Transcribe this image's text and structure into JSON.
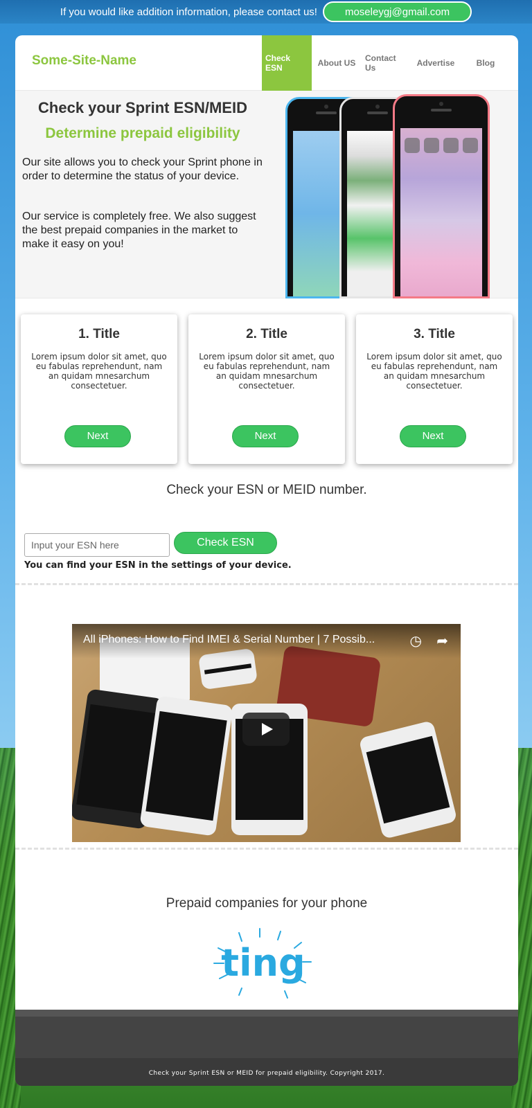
{
  "topbar": {
    "message": "If you would like addition information, please contact us!",
    "email": "moseleygj@gmail.com"
  },
  "header": {
    "site_name": "Some-Site-Name",
    "nav": [
      {
        "label": "Check ESN",
        "active": true
      },
      {
        "label": "About US"
      },
      {
        "label": "Contact Us"
      },
      {
        "label": "Advertise"
      },
      {
        "label": "Blog"
      }
    ]
  },
  "hero": {
    "title": "Check your Sprint ESN/MEID",
    "subtitle": "Determine prepaid eligibility",
    "paragraph1": "Our site allows you to check your Sprint phone in order to determine the status of your device.",
    "paragraph2": "Our service is completely free. We also suggest the best prepaid companies in the market to make it easy on you!"
  },
  "cards": [
    {
      "title": "1. Title",
      "text": "Lorem ipsum dolor sit amet, quo eu fabulas reprehendunt, nam an quidam mnesarchum consectetuer.",
      "button": "Next"
    },
    {
      "title": "2. Title",
      "text": "Lorem ipsum dolor sit amet, quo eu fabulas reprehendunt, nam an quidam mnesarchum consectetuer.",
      "button": "Next"
    },
    {
      "title": "3. Title",
      "text": "Lorem ipsum dolor sit amet, quo eu fabulas reprehendunt, nam an quidam mnesarchum consectetuer.",
      "button": "Next"
    }
  ],
  "check": {
    "title": "Check your ESN or MEID number.",
    "placeholder": "Input your ESN here",
    "button": "Check ESN",
    "hint": "You can find your ESN in the settings of your device."
  },
  "video": {
    "title": "All iPhones: How to Find IMEI & Serial Number | 7 Possib..."
  },
  "prepaid": {
    "title": "Prepaid companies for your phone",
    "logo_text": "ting",
    "logo_color": "#2aa9e0"
  },
  "footer": {
    "copyright": "Check your Sprint ESN or MEID for prepaid eligibility. Copyright 2017."
  },
  "colors": {
    "accent_green": "#8cc63f",
    "button_green": "#3cc460"
  }
}
